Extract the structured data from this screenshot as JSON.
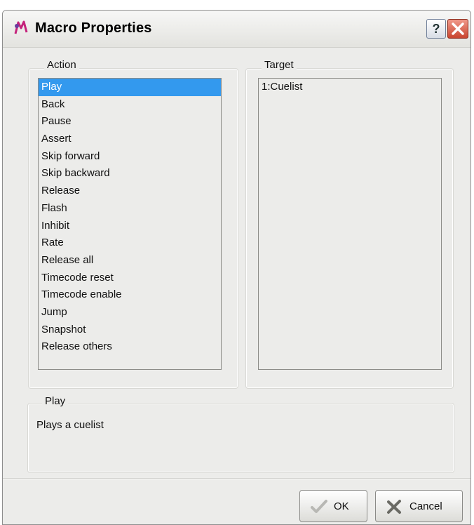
{
  "window": {
    "title": "Macro Properties"
  },
  "action_group": {
    "legend": "Action",
    "items": [
      "Play",
      "Back",
      "Pause",
      "Assert",
      "Skip forward",
      "Skip backward",
      "Release",
      "Flash",
      "Inhibit",
      "Rate",
      "Release all",
      "Timecode reset",
      "Timecode enable",
      "Jump",
      "Snapshot",
      "Release others"
    ],
    "selected_index": 0
  },
  "target_group": {
    "legend": "Target",
    "items": [
      "1:Cuelist"
    ]
  },
  "description_group": {
    "legend": "Play",
    "text": "Plays a cuelist"
  },
  "buttons": {
    "help": "?",
    "ok": "OK",
    "cancel": "Cancel"
  },
  "icons": {
    "app": "macro-icon",
    "ok": "check-icon",
    "cancel": "x-icon",
    "close": "close-icon"
  },
  "colors": {
    "selection": "#3399ee",
    "close_button": "#c9452f",
    "window_bg": "#ececea"
  }
}
